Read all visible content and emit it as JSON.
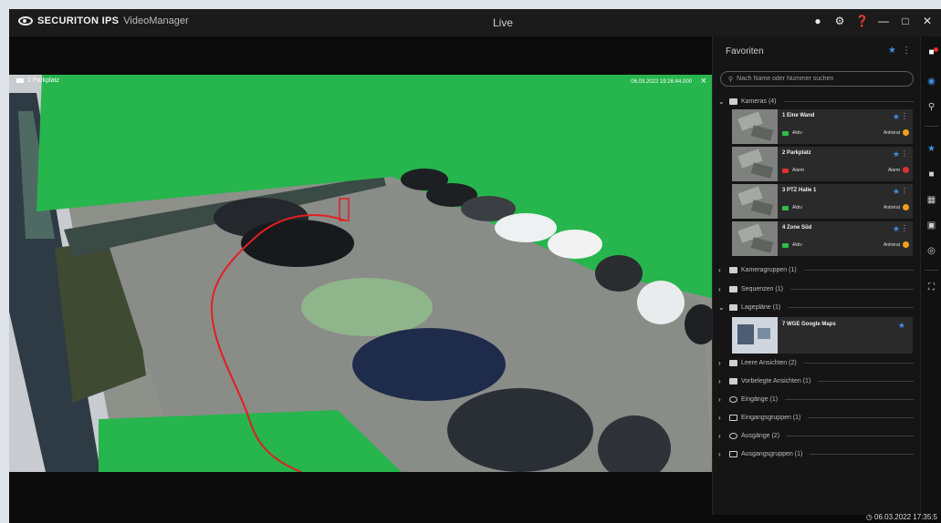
{
  "app": {
    "brand_bold": "SECURITON IPS",
    "brand_product": "VideoManager",
    "window_title": "Live"
  },
  "titlebar_icons": [
    "user-icon",
    "settings-icon",
    "help-icon",
    "minimize-icon",
    "maximize-icon",
    "close-icon"
  ],
  "video": {
    "camera_label": "1 Parkplatz",
    "timestamp": "06.03.2022 19:26:44.000",
    "close_glyph": "×"
  },
  "panel": {
    "title": "Favoriten",
    "search_placeholder": "Nach Name oder Nummer suchen",
    "cameras_group": "Kameras (4)",
    "cameras": [
      {
        "name": "1 Eine Wand",
        "status": "Aktiv",
        "status_color": "#2dbf4a",
        "mode": "Antivirat",
        "mode_color": "#f0a020"
      },
      {
        "name": "2 Parkplatz",
        "status": "Alarm",
        "status_color": "#e0312f",
        "mode": "Alarm",
        "mode_color": "#e0312f"
      },
      {
        "name": "3 PTZ Halle 1",
        "status": "Aktiv",
        "status_color": "#2dbf4a",
        "mode": "Antivirat",
        "mode_color": "#f0a020"
      },
      {
        "name": "4 Zone Süd",
        "status": "Aktiv",
        "status_color": "#2dbf4a",
        "mode": "Antivirat",
        "mode_color": "#f0a020"
      }
    ],
    "group_camera_groups": "Kameragruppen (1)",
    "group_sequences": "Sequenzen (1)",
    "group_maps": "Lagepläne (1)",
    "map_item": "7 WGE Google Maps",
    "group_layout_views": "Leere Ansichten (2)",
    "group_preset_views": "Vorbelegte Ansichten (1)",
    "group_inputs": "Eingänge (1)",
    "group_input_groups": "Eingangsgruppen (1)",
    "group_outputs": "Ausgänge (2)",
    "group_output_groups": "Ausgangsgruppen (1)"
  },
  "status_bar": {
    "datetime": "06.03.2022 17:35:5"
  },
  "colors": {
    "accent": "#3e8fe6",
    "mask_green": "#27b54d",
    "trail_red": "#e02020"
  }
}
